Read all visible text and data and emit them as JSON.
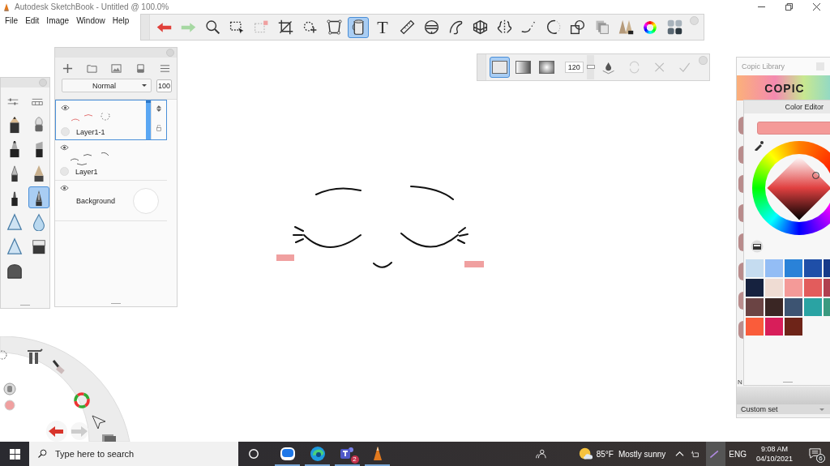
{
  "window": {
    "title": "Autodesk SketchBook - Untitled @ 100.0%"
  },
  "menu": [
    "File",
    "Edit",
    "Image",
    "Window",
    "Help"
  ],
  "toolbar": {
    "tools": [
      {
        "kind": "undo",
        "selected": false
      },
      {
        "kind": "redo",
        "selected": false
      },
      {
        "kind": "zoom",
        "selected": false
      },
      {
        "kind": "select",
        "selected": false
      },
      {
        "kind": "select2",
        "selected": false
      },
      {
        "kind": "crop",
        "selected": false
      },
      {
        "kind": "move",
        "selected": false
      },
      {
        "kind": "distort",
        "selected": false
      },
      {
        "kind": "fill",
        "selected": true
      },
      {
        "kind": "text",
        "glyph": "T",
        "selected": false
      },
      {
        "kind": "ruler",
        "selected": false
      },
      {
        "kind": "ellipse",
        "selected": false
      },
      {
        "kind": "curve",
        "selected": false
      },
      {
        "kind": "perspective",
        "selected": false
      },
      {
        "kind": "symmetry",
        "selected": false
      },
      {
        "kind": "stroke",
        "selected": false
      },
      {
        "kind": "circle",
        "selected": false
      },
      {
        "kind": "shapes",
        "selected": false
      },
      {
        "kind": "copy",
        "selected": false
      },
      {
        "kind": "brushlib",
        "selected": false
      },
      {
        "kind": "color",
        "selected": false
      },
      {
        "kind": "palette",
        "selected": false
      }
    ]
  },
  "fill_bar": {
    "modes": [
      {
        "kind": "solid",
        "selected": true
      },
      {
        "kind": "linear",
        "selected": false
      },
      {
        "kind": "radial",
        "selected": false
      }
    ],
    "tolerance": "120",
    "level": 0.5
  },
  "brush_palette": {
    "brushes": [
      {
        "kind": "pencil",
        "selected": false
      },
      {
        "kind": "airbrush",
        "selected": false
      },
      {
        "kind": "marker",
        "selected": false
      },
      {
        "kind": "chisel",
        "selected": false
      },
      {
        "kind": "pen",
        "selected": false
      },
      {
        "kind": "ink",
        "selected": false
      },
      {
        "kind": "felt",
        "selected": false
      },
      {
        "kind": "nib",
        "selected": true
      },
      {
        "kind": "cone",
        "selected": false
      },
      {
        "kind": "drop",
        "selected": false
      },
      {
        "kind": "cone",
        "selected": false
      },
      {
        "kind": "eraser",
        "selected": false
      },
      {
        "kind": "eraser2",
        "selected": false
      }
    ]
  },
  "layers": {
    "blend_mode": "Normal",
    "opacity": "100",
    "items": [
      {
        "name": "Layer1-1",
        "kind": "strokes",
        "selected": true
      },
      {
        "name": "Layer1",
        "kind": "strokes",
        "selected": false
      },
      {
        "name": "Background",
        "kind": "background",
        "selected": false
      }
    ]
  },
  "copic_library": {
    "title": "Copic Library",
    "logo": "COPIC",
    "hidden_label": "N",
    "set": "Custom set"
  },
  "color_editor": {
    "title": "Color Editor",
    "swatches": [
      {
        "color": "#c5dcf0"
      },
      {
        "color": "#93bdf5"
      },
      {
        "color": "#2a82d8"
      },
      {
        "color": "#1f4fa8"
      },
      {
        "color": "#173a8a"
      },
      {
        "color": "#16223f"
      },
      {
        "color": "#efdcd3"
      },
      {
        "color": "#f49a98"
      },
      {
        "color": "#e25c5c"
      },
      {
        "color": "#b04050"
      },
      {
        "color": "#6b4444"
      },
      {
        "color": "#3a2624"
      },
      {
        "color": "#3d5472"
      },
      {
        "color": "#2aa3a3"
      },
      {
        "color": "#3a9a80"
      },
      {
        "color": "#fa5c3a"
      },
      {
        "color": "#d81e5a"
      },
      {
        "color": "#6e2418"
      }
    ]
  },
  "taskbar": {
    "search_placeholder": "Type here to search",
    "apps": [
      {
        "kind": "zalo"
      },
      {
        "kind": "edge"
      },
      {
        "kind": "teams",
        "badge": "2"
      },
      {
        "kind": "sketchbook"
      }
    ],
    "temperature": "85°F",
    "weather": "Mostly sunny",
    "language": "ENG",
    "time": "9:08 AM",
    "date": "04/10/2021",
    "notifications": "6"
  }
}
